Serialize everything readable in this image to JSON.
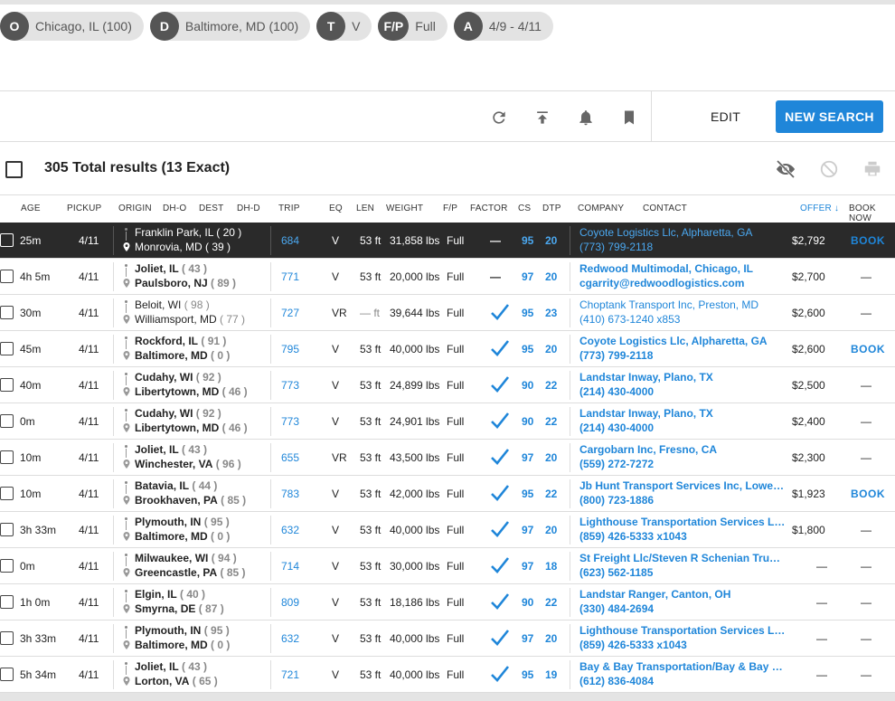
{
  "filters": [
    {
      "badge": "O",
      "text": "Chicago, IL (100)"
    },
    {
      "badge": "D",
      "text": "Baltimore, MD (100)"
    },
    {
      "badge": "T",
      "text": "V"
    },
    {
      "badge": "F/P",
      "text": "Full"
    },
    {
      "badge": "A",
      "text": "4/9 - 4/11"
    }
  ],
  "toolbar": {
    "icons": [
      "refresh-icon",
      "upload-icon",
      "bell-icon",
      "bookmark-icon"
    ],
    "edit_label": "EDIT",
    "new_search_label": "NEW SEARCH"
  },
  "results": {
    "summary": "305 Total results (13 Exact)",
    "icons": [
      "hide-icon",
      "block-icon",
      "print-icon"
    ]
  },
  "columns": [
    "AGE",
    "PICKUP",
    "ORIGIN",
    "DH-O",
    "DEST",
    "DH-D",
    "TRIP",
    "EQ",
    "LEN",
    "WEIGHT",
    "F/P",
    "FACTOR",
    "CS",
    "DTP",
    "COMPANY",
    "CONTACT",
    "OFFER ↓",
    "BOOK NOW"
  ],
  "colors": {
    "accent": "#1f86d9",
    "selected_row": "#2a2a2a"
  },
  "rows": [
    {
      "age": "25m",
      "pickup": "4/11",
      "origin": "Franklin Park, IL",
      "dho": "( 20 )",
      "dest": "Monrovia, MD",
      "dhd": "( 39 )",
      "trip": "684",
      "eq": "V",
      "len": "53 ft",
      "weight": "31,858 lbs",
      "fp": "Full",
      "factor": "dash",
      "cs": "95",
      "dtp": "20",
      "company": "Coyote Logistics Llc, Alpharetta, GA",
      "contact": "(773) 799-2118",
      "offer": "$2,792",
      "book": "BOOK",
      "selected": true,
      "bold_loc": false,
      "bold_co": false
    },
    {
      "age": "4h 5m",
      "pickup": "4/11",
      "origin": "Joliet, IL",
      "dho": "( 43 )",
      "dest": "Paulsboro, NJ",
      "dhd": "( 89 )",
      "trip": "771",
      "eq": "V",
      "len": "53 ft",
      "weight": "20,000 lbs",
      "fp": "Full",
      "factor": "dash",
      "cs": "97",
      "dtp": "20",
      "company": "Redwood Multimodal, Chicago, IL",
      "contact": "cgarrity@redwoodlogistics.com",
      "offer": "$2,700",
      "book": "—",
      "selected": false,
      "bold_loc": true,
      "bold_co": true
    },
    {
      "age": "30m",
      "pickup": "4/11",
      "origin": "Beloit, WI",
      "dho": "( 98 )",
      "dest": "Williamsport, MD",
      "dhd": "( 77 )",
      "trip": "727",
      "eq": "VR",
      "len": "— ft",
      "weight": "39,644 lbs",
      "fp": "Full",
      "factor": "check",
      "cs": "95",
      "dtp": "23",
      "company": "Choptank Transport Inc, Preston, MD",
      "contact": "(410) 673-1240 x853",
      "offer": "$2,600",
      "book": "—",
      "selected": false,
      "bold_loc": false,
      "bold_co": false
    },
    {
      "age": "45m",
      "pickup": "4/11",
      "origin": "Rockford, IL",
      "dho": "( 91 )",
      "dest": "Baltimore, MD",
      "dhd": "( 0 )",
      "trip": "795",
      "eq": "V",
      "len": "53 ft",
      "weight": "40,000 lbs",
      "fp": "Full",
      "factor": "check",
      "cs": "95",
      "dtp": "20",
      "company": "Coyote Logistics Llc, Alpharetta, GA",
      "contact": "(773) 799-2118",
      "offer": "$2,600",
      "book": "BOOK",
      "selected": false,
      "bold_loc": true,
      "bold_co": true
    },
    {
      "age": "40m",
      "pickup": "4/11",
      "origin": "Cudahy, WI",
      "dho": "( 92 )",
      "dest": "Libertytown, MD",
      "dhd": "( 46 )",
      "trip": "773",
      "eq": "V",
      "len": "53 ft",
      "weight": "24,899 lbs",
      "fp": "Full",
      "factor": "check",
      "cs": "90",
      "dtp": "22",
      "company": "Landstar Inway, Plano, TX",
      "contact": "(214) 430-4000",
      "offer": "$2,500",
      "book": "—",
      "selected": false,
      "bold_loc": true,
      "bold_co": true
    },
    {
      "age": "0m",
      "pickup": "4/11",
      "origin": "Cudahy, WI",
      "dho": "( 92 )",
      "dest": "Libertytown, MD",
      "dhd": "( 46 )",
      "trip": "773",
      "eq": "V",
      "len": "53 ft",
      "weight": "24,901 lbs",
      "fp": "Full",
      "factor": "check",
      "cs": "90",
      "dtp": "22",
      "company": "Landstar Inway, Plano, TX",
      "contact": "(214) 430-4000",
      "offer": "$2,400",
      "book": "—",
      "selected": false,
      "bold_loc": true,
      "bold_co": true
    },
    {
      "age": "10m",
      "pickup": "4/11",
      "origin": "Joliet, IL",
      "dho": "( 43 )",
      "dest": "Winchester, VA",
      "dhd": "( 96 )",
      "trip": "655",
      "eq": "VR",
      "len": "53 ft",
      "weight": "43,500 lbs",
      "fp": "Full",
      "factor": "check",
      "cs": "97",
      "dtp": "20",
      "company": "Cargobarn Inc, Fresno, CA",
      "contact": "(559) 272-7272",
      "offer": "$2,300",
      "book": "—",
      "selected": false,
      "bold_loc": true,
      "bold_co": true
    },
    {
      "age": "10m",
      "pickup": "4/11",
      "origin": "Batavia, IL",
      "dho": "( 44 )",
      "dest": "Brookhaven, PA",
      "dhd": "( 85 )",
      "trip": "783",
      "eq": "V",
      "len": "53 ft",
      "weight": "42,000 lbs",
      "fp": "Full",
      "factor": "check",
      "cs": "95",
      "dtp": "22",
      "company": "Jb Hunt Transport Services Inc, Lowell,...",
      "contact": "(800) 723-1886",
      "offer": "$1,923",
      "book": "BOOK",
      "selected": false,
      "bold_loc": true,
      "bold_co": true
    },
    {
      "age": "3h 33m",
      "pickup": "4/11",
      "origin": "Plymouth, IN",
      "dho": "( 95 )",
      "dest": "Baltimore, MD",
      "dhd": "( 0 )",
      "trip": "632",
      "eq": "V",
      "len": "53 ft",
      "weight": "40,000 lbs",
      "fp": "Full",
      "factor": "check",
      "cs": "97",
      "dtp": "20",
      "company": "Lighthouse Transportation Services Llc...",
      "contact": "(859) 426-5333 x1043",
      "offer": "$1,800",
      "book": "—",
      "selected": false,
      "bold_loc": true,
      "bold_co": true
    },
    {
      "age": "0m",
      "pickup": "4/11",
      "origin": "Milwaukee, WI",
      "dho": "( 94 )",
      "dest": "Greencastle, PA",
      "dhd": "( 85 )",
      "trip": "714",
      "eq": "V",
      "len": "53 ft",
      "weight": "30,000 lbs",
      "fp": "Full",
      "factor": "check",
      "cs": "97",
      "dtp": "18",
      "company": "St Freight Llc/Steven R Schenian Truck...",
      "contact": "(623) 562-1185",
      "offer": "—",
      "book": "—",
      "selected": false,
      "bold_loc": true,
      "bold_co": true
    },
    {
      "age": "1h 0m",
      "pickup": "4/11",
      "origin": "Elgin, IL",
      "dho": "( 40 )",
      "dest": "Smyrna, DE",
      "dhd": "( 87 )",
      "trip": "809",
      "eq": "V",
      "len": "53 ft",
      "weight": "18,186 lbs",
      "fp": "Full",
      "factor": "check",
      "cs": "90",
      "dtp": "22",
      "company": "Landstar Ranger, Canton, OH",
      "contact": "(330) 484-2694",
      "offer": "—",
      "book": "—",
      "selected": false,
      "bold_loc": true,
      "bold_co": true
    },
    {
      "age": "3h 33m",
      "pickup": "4/11",
      "origin": "Plymouth, IN",
      "dho": "( 95 )",
      "dest": "Baltimore, MD",
      "dhd": "( 0 )",
      "trip": "632",
      "eq": "V",
      "len": "53 ft",
      "weight": "40,000 lbs",
      "fp": "Full",
      "factor": "check",
      "cs": "97",
      "dtp": "20",
      "company": "Lighthouse Transportation Services Llc...",
      "contact": "(859) 426-5333 x1043",
      "offer": "—",
      "book": "—",
      "selected": false,
      "bold_loc": true,
      "bold_co": true
    },
    {
      "age": "5h 34m",
      "pickup": "4/11",
      "origin": "Joliet, IL",
      "dho": "( 43 )",
      "dest": "Lorton, VA",
      "dhd": "( 65 )",
      "trip": "721",
      "eq": "V",
      "len": "53 ft",
      "weight": "40,000 lbs",
      "fp": "Full",
      "factor": "check",
      "cs": "95",
      "dtp": "19",
      "company": "Bay & Bay Transportation/Bay & Bay Tr...",
      "contact": "(612) 836-4084",
      "offer": "—",
      "book": "—",
      "selected": false,
      "bold_loc": true,
      "bold_co": true
    }
  ]
}
